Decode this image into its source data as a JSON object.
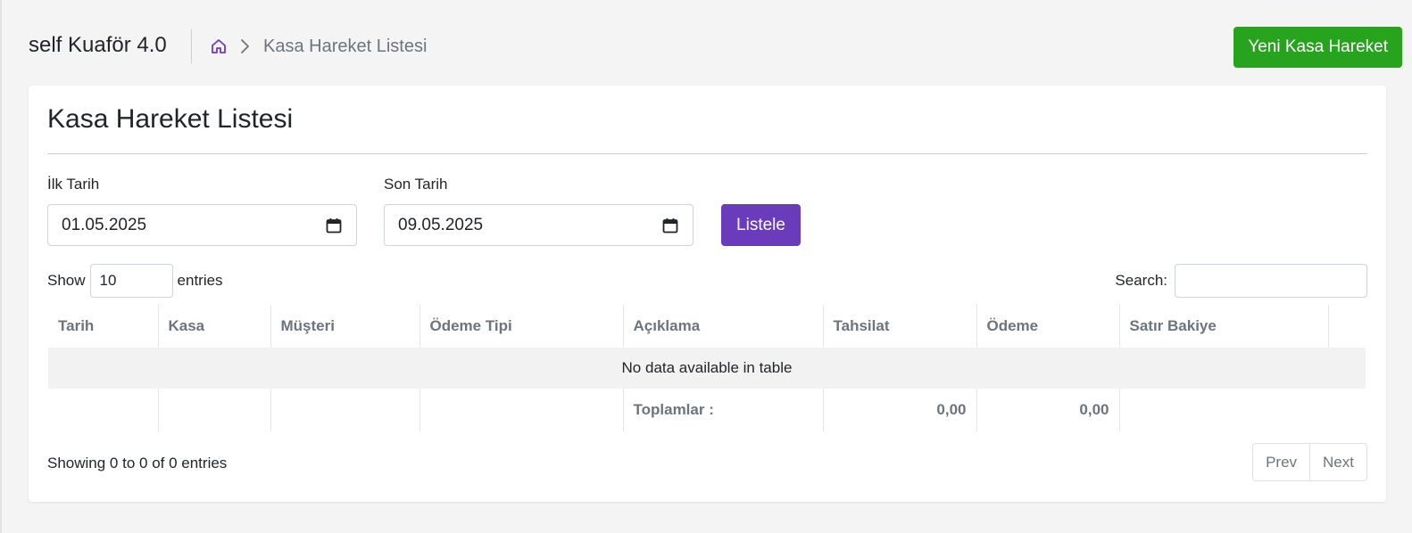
{
  "header": {
    "app_title": "self Kuaför 4.0",
    "breadcrumb_current": "Kasa Hareket Listesi",
    "new_button": "Yeni Kasa Hareket"
  },
  "card": {
    "title": "Kasa Hareket Listesi",
    "filters": {
      "start_label": "İlk Tarih",
      "start_value": "01.05.2025",
      "end_label": "Son Tarih",
      "end_value": "09.05.2025",
      "list_button": "Listele"
    },
    "table_controls": {
      "show_label": "Show",
      "page_length": "10",
      "entries_label": "entries",
      "search_label": "Search:"
    },
    "table": {
      "columns": [
        "Tarih",
        "Kasa",
        "Müşteri",
        "Ödeme Tipi",
        "Açıklama",
        "Tahsilat",
        "Ödeme",
        "Satır Bakiye",
        ""
      ],
      "empty_message": "No data available in table",
      "footer": {
        "label": "Toplamlar :",
        "tahsilat_total": "0,00",
        "odeme_total": "0,00"
      }
    },
    "info": "Showing 0 to 0 of 0 entries",
    "pager": {
      "prev": "Prev",
      "next": "Next"
    }
  },
  "colors": {
    "page_bg": "#f4f4f4",
    "new_button": "#27a31d",
    "list_button": "#6a3cbc",
    "home_icon": "#6a3cbc"
  },
  "icons": [
    "home-icon",
    "chevron-right-icon",
    "calendar-icon"
  ]
}
